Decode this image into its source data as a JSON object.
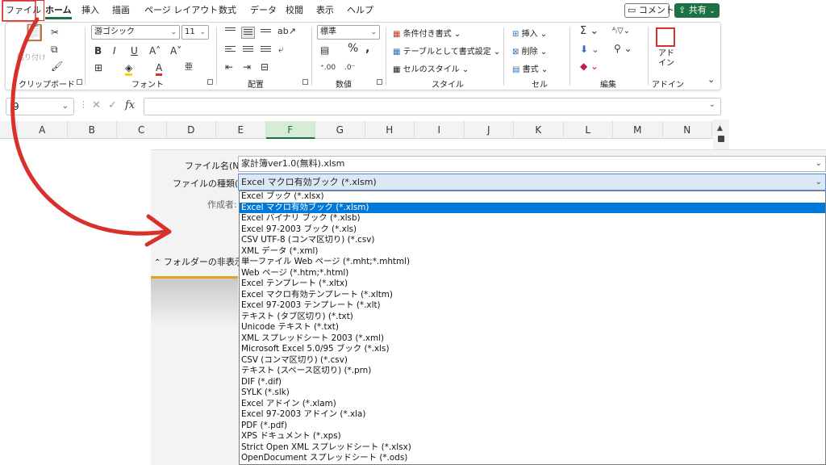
{
  "menu": {
    "tabs": [
      "ファイル",
      "ホーム",
      "挿入",
      "描画",
      "ページ レイアウト",
      "数式",
      "データ",
      "校閲",
      "表示",
      "ヘルプ"
    ],
    "comment_label": "コメント",
    "share_label": "共有"
  },
  "ribbon": {
    "clipboard": {
      "label": "クリップボード",
      "paste_label": "貼り付け"
    },
    "font": {
      "label": "フォント",
      "name": "游ゴシック",
      "size": "11",
      "bold": "B",
      "italic": "I",
      "underline": "U"
    },
    "alignment": {
      "label": "配置"
    },
    "number": {
      "label": "数値",
      "format": "標準"
    },
    "styles": {
      "label": "スタイル",
      "conditional": "条件付き書式",
      "table": "テーブルとして書式設定",
      "cell_styles": "セルのスタイル"
    },
    "cells": {
      "label": "セル",
      "insert": "挿入",
      "delete": "削除",
      "format": "書式"
    },
    "editing": {
      "label": "編集"
    },
    "addins": {
      "label": "アドイン",
      "button": "アド\nイン"
    }
  },
  "formula_bar": {
    "name_box": "9",
    "fx": "fx"
  },
  "columns": [
    "A",
    "B",
    "C",
    "D",
    "E",
    "F",
    "G",
    "H",
    "I",
    "J",
    "K",
    "L",
    "M",
    "N"
  ],
  "selected_column": "F",
  "dialog": {
    "filename_label": "ファイル名(N):",
    "filename_value": "家計簿ver1.0(無料).xlsm",
    "filetype_label": "ファイルの種類(T):",
    "filetype_value": "Excel マクロ有効ブック (*.xlsm)",
    "author_label": "作成者:",
    "folder_toggle": "フォルダーの非表示"
  },
  "file_types": [
    "Excel ブック (*.xlsx)",
    "Excel マクロ有効ブック (*.xlsm)",
    "Excel バイナリ ブック (*.xlsb)",
    "Excel 97-2003 ブック (*.xls)",
    "CSV UTF-8 (コンマ区切り) (*.csv)",
    "XML データ (*.xml)",
    "単一ファイル Web ページ (*.mht;*.mhtml)",
    "Web ページ (*.htm;*.html)",
    "Excel テンプレート (*.xltx)",
    "Excel マクロ有効テンプレート (*.xltm)",
    "Excel 97-2003 テンプレート (*.xlt)",
    "テキスト (タブ区切り) (*.txt)",
    "Unicode テキスト (*.txt)",
    "XML スプレッドシート 2003 (*.xml)",
    "Microsoft Excel 5.0/95 ブック (*.xls)",
    "CSV (コンマ区切り) (*.csv)",
    "テキスト (スペース区切り) (*.prn)",
    "DIF (*.dif)",
    "SYLK (*.slk)",
    "Excel アドイン (*.xlam)",
    "Excel 97-2003 アドイン (*.xla)",
    "PDF (*.pdf)",
    "XPS ドキュメント (*.xps)",
    "Strict Open XML スプレッドシート (*.xlsx)",
    "OpenDocument スプレッドシート (*.ods)"
  ],
  "selected_file_type_index": 1,
  "colors": {
    "accent_green": "#1e7145",
    "selection_blue": "#0078d7",
    "annotation_red": "#d9302c"
  }
}
